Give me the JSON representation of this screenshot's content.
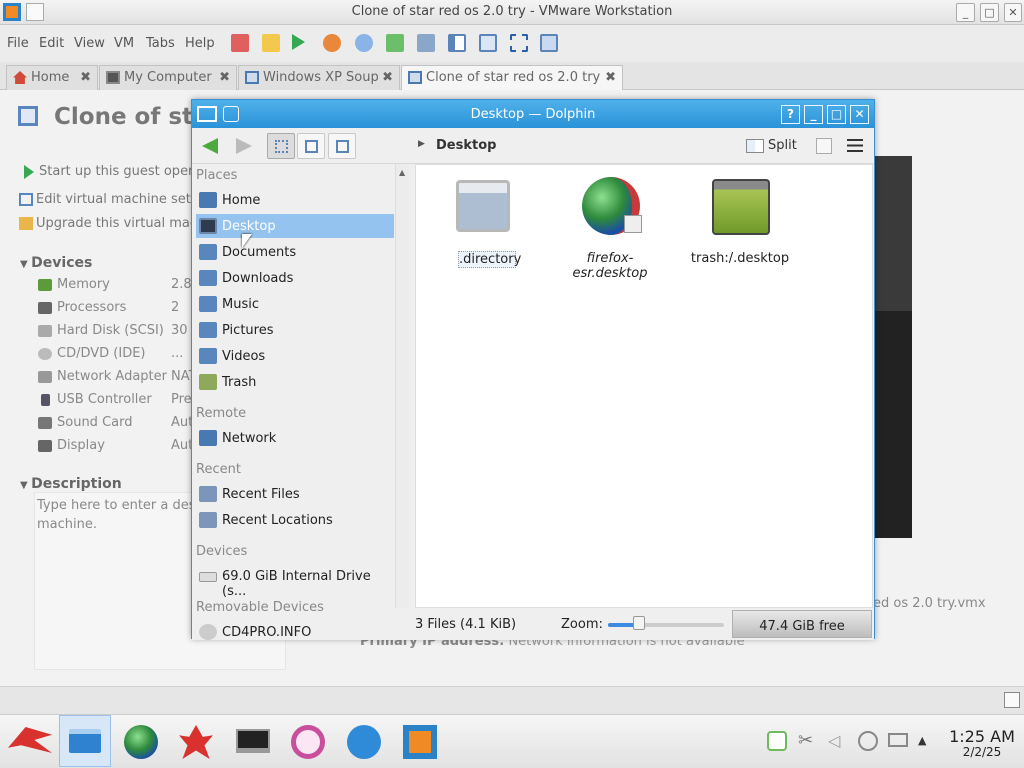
{
  "vmware": {
    "window_title": "Clone of star red os 2.0 try - VMware Workstation",
    "menu": [
      "File",
      "Edit",
      "View",
      "VM",
      "Tabs",
      "Help"
    ],
    "tabs": [
      {
        "label": "Home",
        "icon": "home-icon"
      },
      {
        "label": "My Computer",
        "icon": "computer-icon"
      },
      {
        "label": "Windows XP Soup",
        "icon": "vm-icon"
      },
      {
        "label": "Clone of star red os 2.0 try",
        "icon": "vm-icon",
        "active": true
      }
    ],
    "vm_title": "Clone of sta",
    "actions": [
      "Start up this guest opera",
      "Edit virtual machine settin",
      "Upgrade this virtual mach"
    ],
    "devices_header": "Devices",
    "devices": [
      {
        "name": "Memory",
        "value": "2.8"
      },
      {
        "name": "Processors",
        "value": "2"
      },
      {
        "name": "Hard Disk (SCSI)",
        "value": "30"
      },
      {
        "name": "CD/DVD (IDE)",
        "value": "..."
      },
      {
        "name": "Network Adapter",
        "value": "NAT"
      },
      {
        "name": "USB Controller",
        "value": "Pre"
      },
      {
        "name": "Sound Card",
        "value": "Aut"
      },
      {
        "name": "Display",
        "value": "Aut"
      }
    ],
    "description_header": "Description",
    "description_placeholder": "Type here to enter a desc virtual machine.",
    "vmx_fragment": "ed os 2.0 try.vmx",
    "ip_label": "Primary IP address:",
    "ip_value": "Network information is not available"
  },
  "dolphin": {
    "window_title": "Desktop — Dolphin",
    "breadcrumb": "Desktop",
    "split_label": "Split",
    "places": {
      "places_header": "Places",
      "places_items": [
        "Home",
        "Desktop",
        "Documents",
        "Downloads",
        "Music",
        "Pictures",
        "Videos",
        "Trash"
      ],
      "selected": "Desktop",
      "remote_header": "Remote",
      "remote_items": [
        "Network"
      ],
      "recent_header": "Recent",
      "recent_items": [
        "Recent Files",
        "Recent Locations"
      ],
      "devices_header": "Devices",
      "devices_items": [
        "69.0 GiB Internal Drive (s..."
      ],
      "drive_usage": 0.31,
      "removable_header": "Removable Devices",
      "removable_items": [
        "CD4PRO.INFO"
      ]
    },
    "files": [
      {
        "name": ".directory",
        "icon": "generic-file-icon"
      },
      {
        "name": "firefox-esr.desktop",
        "icon": "firefox-icon"
      },
      {
        "name": "trash:/.desktop",
        "icon": "trash-icon"
      }
    ],
    "status": {
      "file_count": "3 Files (4.1 KiB)",
      "zoom_label": "Zoom:",
      "zoom_level": 0.27,
      "free_space": "47.4 GiB free"
    }
  },
  "taskbar": {
    "apps": [
      "app-menu-icon",
      "dolphin-icon",
      "globe-browser-icon",
      "lobster-app-icon",
      "terminal-icon",
      "circle-app-icon",
      "falkon-icon",
      "vmware-icon"
    ],
    "clock_time": "1:25 AM",
    "clock_date": "2/2/25"
  },
  "colors": {
    "dolphin_title": "#2a92d8",
    "selection": "#93c3ee",
    "accent": "#3d8be0"
  }
}
